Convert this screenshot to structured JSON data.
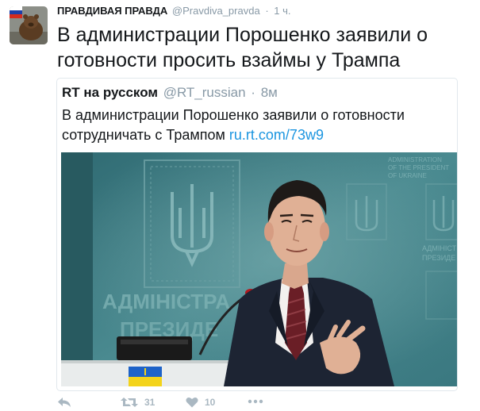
{
  "tweet": {
    "author_name": "ПРАВДИВАЯ ПРАВДА",
    "author_handle": "@Pravdiva_pravda",
    "separator": "·",
    "time": "1 ч.",
    "text": "В администрации Порошенко заявили о готовности просить взаймы у Трампа"
  },
  "quoted": {
    "author_name": "RT на русском",
    "author_handle": "@RT_russian",
    "separator": "·",
    "time": "8м",
    "text": "В администрации Порошенко заявили о готовности сотрудничать с Трампом",
    "link": "ru.rt.com/73w9",
    "image": {
      "wall_text_line1": "АДМІНІСТРА",
      "wall_text_line2": "ПРЕЗИДЕ",
      "small_text_line1": "ADMINISTRATION",
      "small_text_line2": "OF THE PRESIDENT",
      "small_text_line3": "OF UKRAINE",
      "small_text_line4": "АДМІНІСТ",
      "small_text_line5": "ПРЕЗИДЕ"
    }
  },
  "actions": {
    "reply_icon": "reply-icon",
    "retweet_icon": "retweet-icon",
    "retweet_count": "31",
    "like_icon": "heart-icon",
    "like_count": "10",
    "more_icon": "more-icon"
  },
  "colors": {
    "link": "#1b95e0",
    "muted": "#8899a6",
    "action": "#aab8c2",
    "wall": "#3f7f86"
  }
}
